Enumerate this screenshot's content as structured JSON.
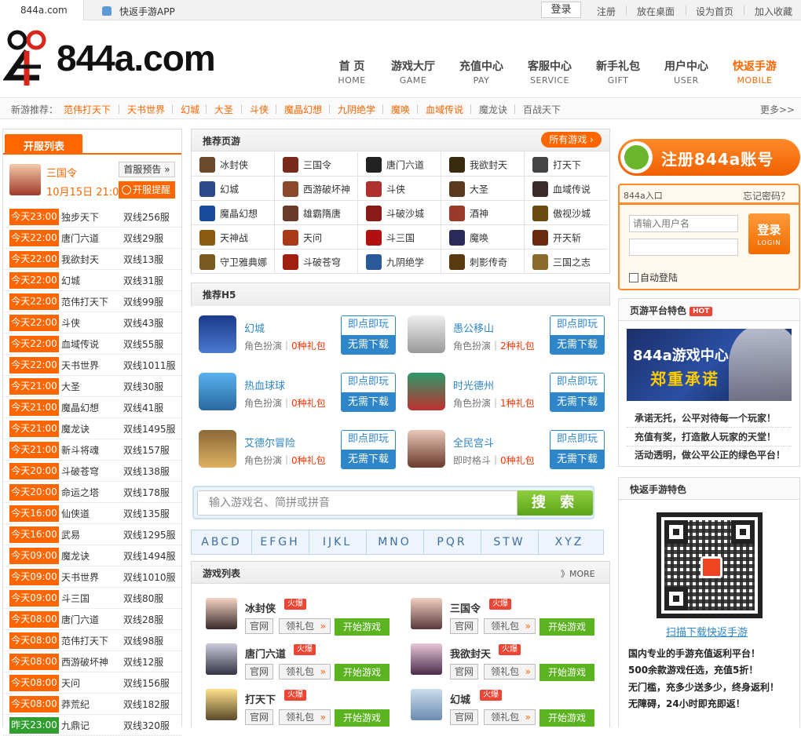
{
  "topbar": {
    "site_tab": "844a.com",
    "app_tab": "快返手游APP",
    "login": "登录",
    "links": [
      "注册",
      "放在桌面",
      "设为首页",
      "加入收藏"
    ]
  },
  "logo": {
    "text": "844a.com"
  },
  "nav": [
    {
      "cn": "首 页",
      "en": "HOME"
    },
    {
      "cn": "游戏大厅",
      "en": "GAME"
    },
    {
      "cn": "充值中心",
      "en": "PAY"
    },
    {
      "cn": "客服中心",
      "en": "SERVICE"
    },
    {
      "cn": "新手礼包",
      "en": "GIFT"
    },
    {
      "cn": "用户中心",
      "en": "USER"
    },
    {
      "cn": "快返手游",
      "en": "MOBILE"
    }
  ],
  "recommend_strip": {
    "label": "新游推荐：",
    "items": [
      "范伟打天下",
      "天书世界",
      "幻城",
      "大圣",
      "斗侠",
      "魔晶幻想",
      "九阴绝学",
      "魔唤",
      "血域传说",
      "魔龙诀",
      "百战天下"
    ],
    "more": "更多>>"
  },
  "server_list": {
    "title": "开服列表",
    "featured": {
      "name": "三国令",
      "time": "10月15日 21:00",
      "preview_btn": "首服预告 »",
      "remind_btn": "开服提醒"
    },
    "rows": [
      {
        "t": "今天23:00",
        "g": "独步天下",
        "s": "双线256服"
      },
      {
        "t": "今天22:00",
        "g": "唐门六道",
        "s": "双线29服"
      },
      {
        "t": "今天22:00",
        "g": "我欲封天",
        "s": "双线13服"
      },
      {
        "t": "今天22:00",
        "g": "幻城",
        "s": "双线31服"
      },
      {
        "t": "今天22:00",
        "g": "范伟打天下",
        "s": "双线99服"
      },
      {
        "t": "今天22:00",
        "g": "斗侠",
        "s": "双线43服"
      },
      {
        "t": "今天22:00",
        "g": "血域传说",
        "s": "双线55服"
      },
      {
        "t": "今天22:00",
        "g": "天书世界",
        "s": "双线1011服"
      },
      {
        "t": "今天21:00",
        "g": "大圣",
        "s": "双线30服"
      },
      {
        "t": "今天21:00",
        "g": "魔晶幻想",
        "s": "双线41服"
      },
      {
        "t": "今天21:00",
        "g": "魔龙诀",
        "s": "双线1495服"
      },
      {
        "t": "今天21:00",
        "g": "新斗将魂",
        "s": "双线157服"
      },
      {
        "t": "今天20:00",
        "g": "斗破苍穹",
        "s": "双线138服"
      },
      {
        "t": "今天20:00",
        "g": "命运之塔",
        "s": "双线178服"
      },
      {
        "t": "今天16:00",
        "g": "仙侠道",
        "s": "双线135服"
      },
      {
        "t": "今天16:00",
        "g": "武易",
        "s": "双线1295服"
      },
      {
        "t": "今天09:00",
        "g": "魔龙诀",
        "s": "双线1494服"
      },
      {
        "t": "今天09:00",
        "g": "天书世界",
        "s": "双线1010服"
      },
      {
        "t": "今天09:00",
        "g": "斗三国",
        "s": "双线80服"
      },
      {
        "t": "今天08:00",
        "g": "唐门六道",
        "s": "双线28服"
      },
      {
        "t": "今天08:00",
        "g": "范伟打天下",
        "s": "双线98服"
      },
      {
        "t": "今天08:00",
        "g": "西游破坏神",
        "s": "双线12服"
      },
      {
        "t": "今天08:00",
        "g": "天问",
        "s": "双线156服"
      },
      {
        "t": "今天08:00",
        "g": "莽荒纪",
        "s": "双线182服"
      },
      {
        "t": "昨天23:00",
        "g": "九鼎记",
        "s": "双线320服"
      }
    ]
  },
  "rec_games": {
    "title": "推荐页游",
    "all_btn": "所有游戏 ›",
    "grid": [
      [
        "冰封侠",
        "三国令",
        "唐门六道",
        "我欲封天",
        "打天下"
      ],
      [
        "幻城",
        "西游破坏神",
        "斗侠",
        "大圣",
        "血域传说"
      ],
      [
        "魔晶幻想",
        "雄霸隋唐",
        "斗破沙城",
        "酒神",
        "傲视沙城"
      ],
      [
        "天神战",
        "天问",
        "斗三国",
        "魔唤",
        "开天斩"
      ],
      [
        "守卫雅典娜",
        "斗破苍穹",
        "九阴绝学",
        "刺影传奇",
        "三国之志"
      ]
    ]
  },
  "h5": {
    "title": "推荐H5",
    "items": [
      {
        "name": "幻城",
        "type": "角色扮演",
        "gift": "0种礼包"
      },
      {
        "name": "愚公移山",
        "type": "角色扮演",
        "gift": "2种礼包"
      },
      {
        "name": "热血球球",
        "type": "角色扮演",
        "gift": "0种礼包"
      },
      {
        "name": "时光德州",
        "type": "角色扮演",
        "gift": "1种礼包"
      },
      {
        "name": "艾德尔冒险",
        "type": "角色扮演",
        "gift": "0种礼包"
      },
      {
        "name": "全民宫斗",
        "type": "即时格斗",
        "gift": "0种礼包"
      }
    ],
    "play_btn": "即点即玩",
    "nodl_btn": "无需下载"
  },
  "search": {
    "placeholder": "输入游戏名、简拼或拼音",
    "button": "搜 索"
  },
  "alpha": [
    "ABCD",
    "EFGH",
    "IJKL",
    "MNO",
    "PQR",
    "STW",
    "XYZ"
  ],
  "game_list": {
    "title": "游戏列表",
    "more": "》MORE",
    "items": [
      "冰封侠",
      "三国令",
      "唐门六道",
      "我欲封天",
      "打天下",
      "幻城"
    ],
    "hot": "火爆",
    "official": "官网",
    "gift": "领礼包",
    "start": "开始游戏"
  },
  "register": {
    "label": "注册844a账号"
  },
  "login_box": {
    "title": "844a入口",
    "forgot": "忘记密码？",
    "username_placeholder": "请输入用户名",
    "button": "登录",
    "button_en": "LOGIN",
    "auto": "自动登陆"
  },
  "platform": {
    "title": "页游平台特色",
    "hot": "HOT",
    "banner_line1": "844a游戏中心",
    "banner_line2": "郑重承诺",
    "lines": [
      "承诺无托，公平对待每一个玩家！",
      "充值有奖，打造散人玩家的天堂！",
      "活动透明，做公平公正的绿色平台！"
    ]
  },
  "mobile": {
    "title": "快返手游特色",
    "download": "扫描下载快返手游",
    "lines": [
      "国内专业的手游充值返利平台！",
      "500余款游戏任选，充值5折！",
      "无门槛，充多少送多少，终身返利！",
      "无障碍，24小时即充即返！"
    ]
  },
  "colors": {
    "accent": "#ff6600",
    "blue": "#2e86c8",
    "green": "#5bb41f"
  }
}
